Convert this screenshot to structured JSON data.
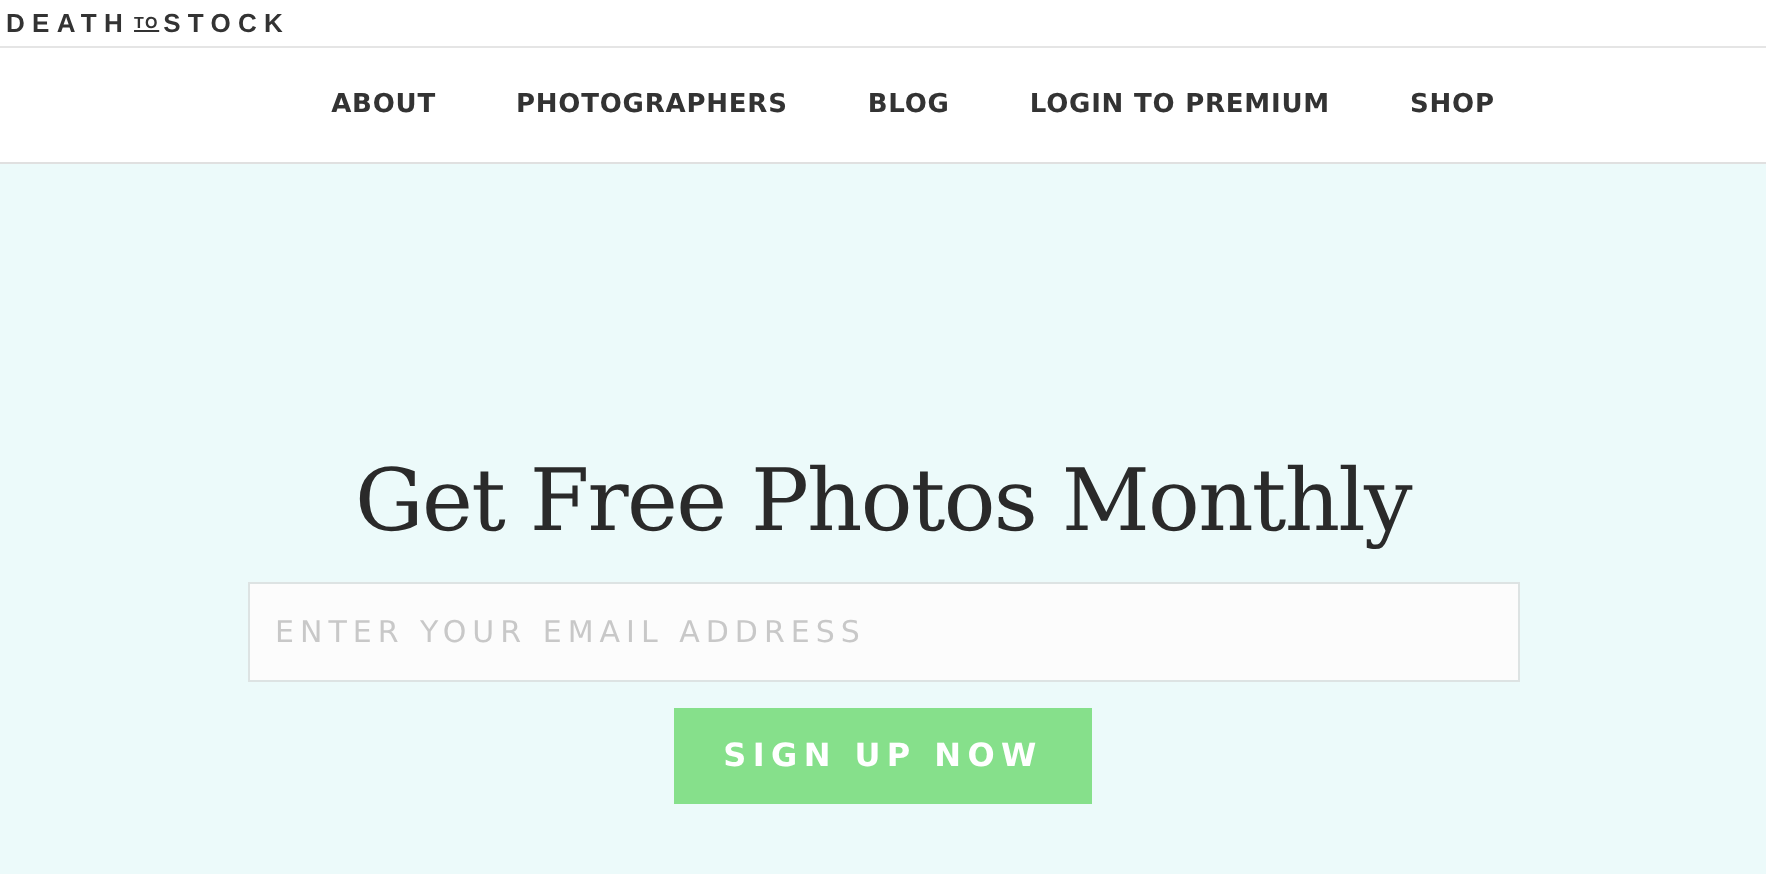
{
  "logo": {
    "parts": [
      "DEATH",
      "TO",
      "STOCK"
    ]
  },
  "nav": [
    "ABOUT",
    "PHOTOGRAPHERS",
    "BLOG",
    "LOGIN TO PREMIUM",
    "SHOP"
  ],
  "hero": {
    "title": "Get Free Photos Monthly",
    "email": {
      "placeholder": "ENTER YOUR EMAIL ADDRESS"
    },
    "button": "SIGN UP NOW"
  }
}
